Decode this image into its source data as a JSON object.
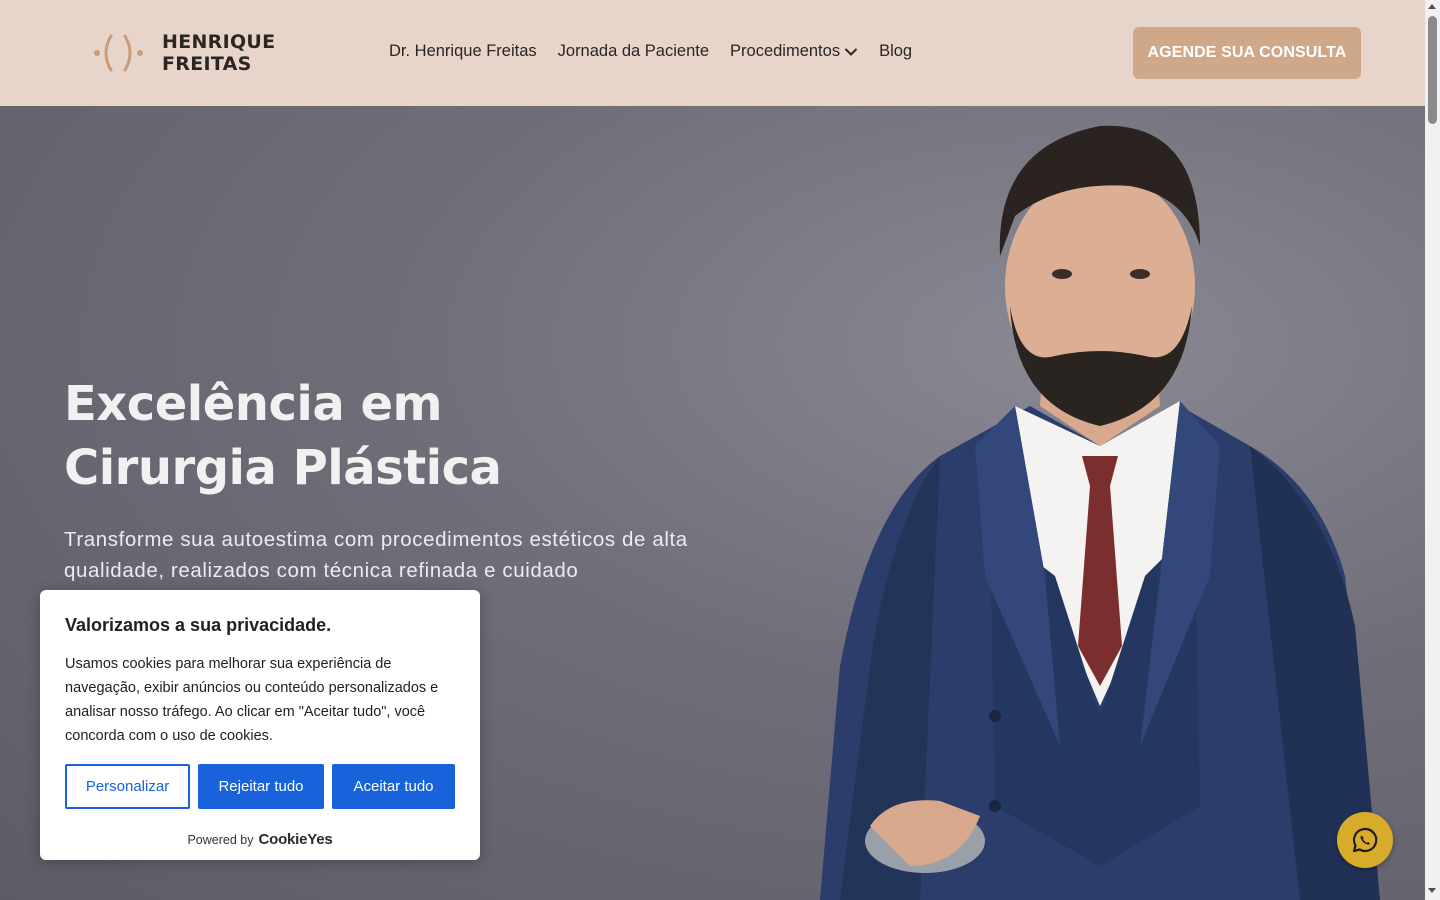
{
  "header": {
    "logo": {
      "line1": "HENRIQUE",
      "line2": "FREITAS",
      "accent": "#c99b78"
    },
    "nav": [
      {
        "label": "Dr. Henrique Freitas"
      },
      {
        "label": "Jornada da Paciente"
      },
      {
        "label": "Procedimentos",
        "has_dropdown": true
      },
      {
        "label": "Blog"
      }
    ],
    "cta_label": "AGENDE SUA CONSULTA",
    "background": "#e7d5ca",
    "cta_color": "#cfa88a"
  },
  "hero": {
    "title_line1": "Excelência em",
    "title_line2": "Cirurgia Plástica",
    "subtitle": "Transforme sua autoestima com procedimentos estéticos de alta qualidade, realizados com técnica refinada e cuidado",
    "image": "portrait-of-surgeon-in-blue-suit"
  },
  "cookie_banner": {
    "title": "Valorizamos a sua privacidade.",
    "text": "Usamos cookies para melhorar sua experiência de navegação, exibir anúncios ou conteúdo personalizados e analisar nosso tráfego. Ao clicar em \"Aceitar tudo\", você concorda com o uso de cookies.",
    "customize_label": "Personalizar",
    "reject_label": "Rejeitar tudo",
    "accept_label": "Aceitar tudo",
    "powered_by": "Powered by",
    "brand": "CookieYes",
    "button_color": "#1863dc"
  },
  "floating": {
    "whatsapp_icon": "whatsapp-icon",
    "color": "#d9ab2b"
  }
}
